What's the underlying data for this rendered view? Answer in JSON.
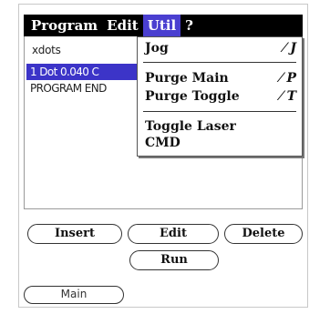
{
  "menubar": {
    "items": [
      {
        "label": "Program",
        "active": false
      },
      {
        "label": "Edit",
        "active": false
      },
      {
        "label": "Util",
        "active": true
      },
      {
        "label": "?",
        "active": false
      }
    ]
  },
  "list": {
    "header": "xdots",
    "rows": [
      {
        "label": "1 Dot 0.040 C",
        "selected": true
      },
      {
        "label": "PROGRAM END",
        "selected": false
      }
    ]
  },
  "util_menu": {
    "items": [
      {
        "label": "Jog",
        "shortcut": "⁄ J"
      },
      {
        "label": "Purge Main",
        "shortcut": "⁄ P"
      },
      {
        "label": "Purge Toggle",
        "shortcut": "⁄ T"
      },
      {
        "label": "Toggle Laser",
        "shortcut": ""
      },
      {
        "label": "CMD",
        "shortcut": ""
      }
    ]
  },
  "buttons": {
    "insert": "Insert",
    "edit": "Edit",
    "delete": "Delete",
    "run": "Run",
    "main": "Main"
  },
  "colors": {
    "menubar_bg": "#000000",
    "active_menu": "#4a3fd0",
    "selection": "#3c34c8"
  }
}
